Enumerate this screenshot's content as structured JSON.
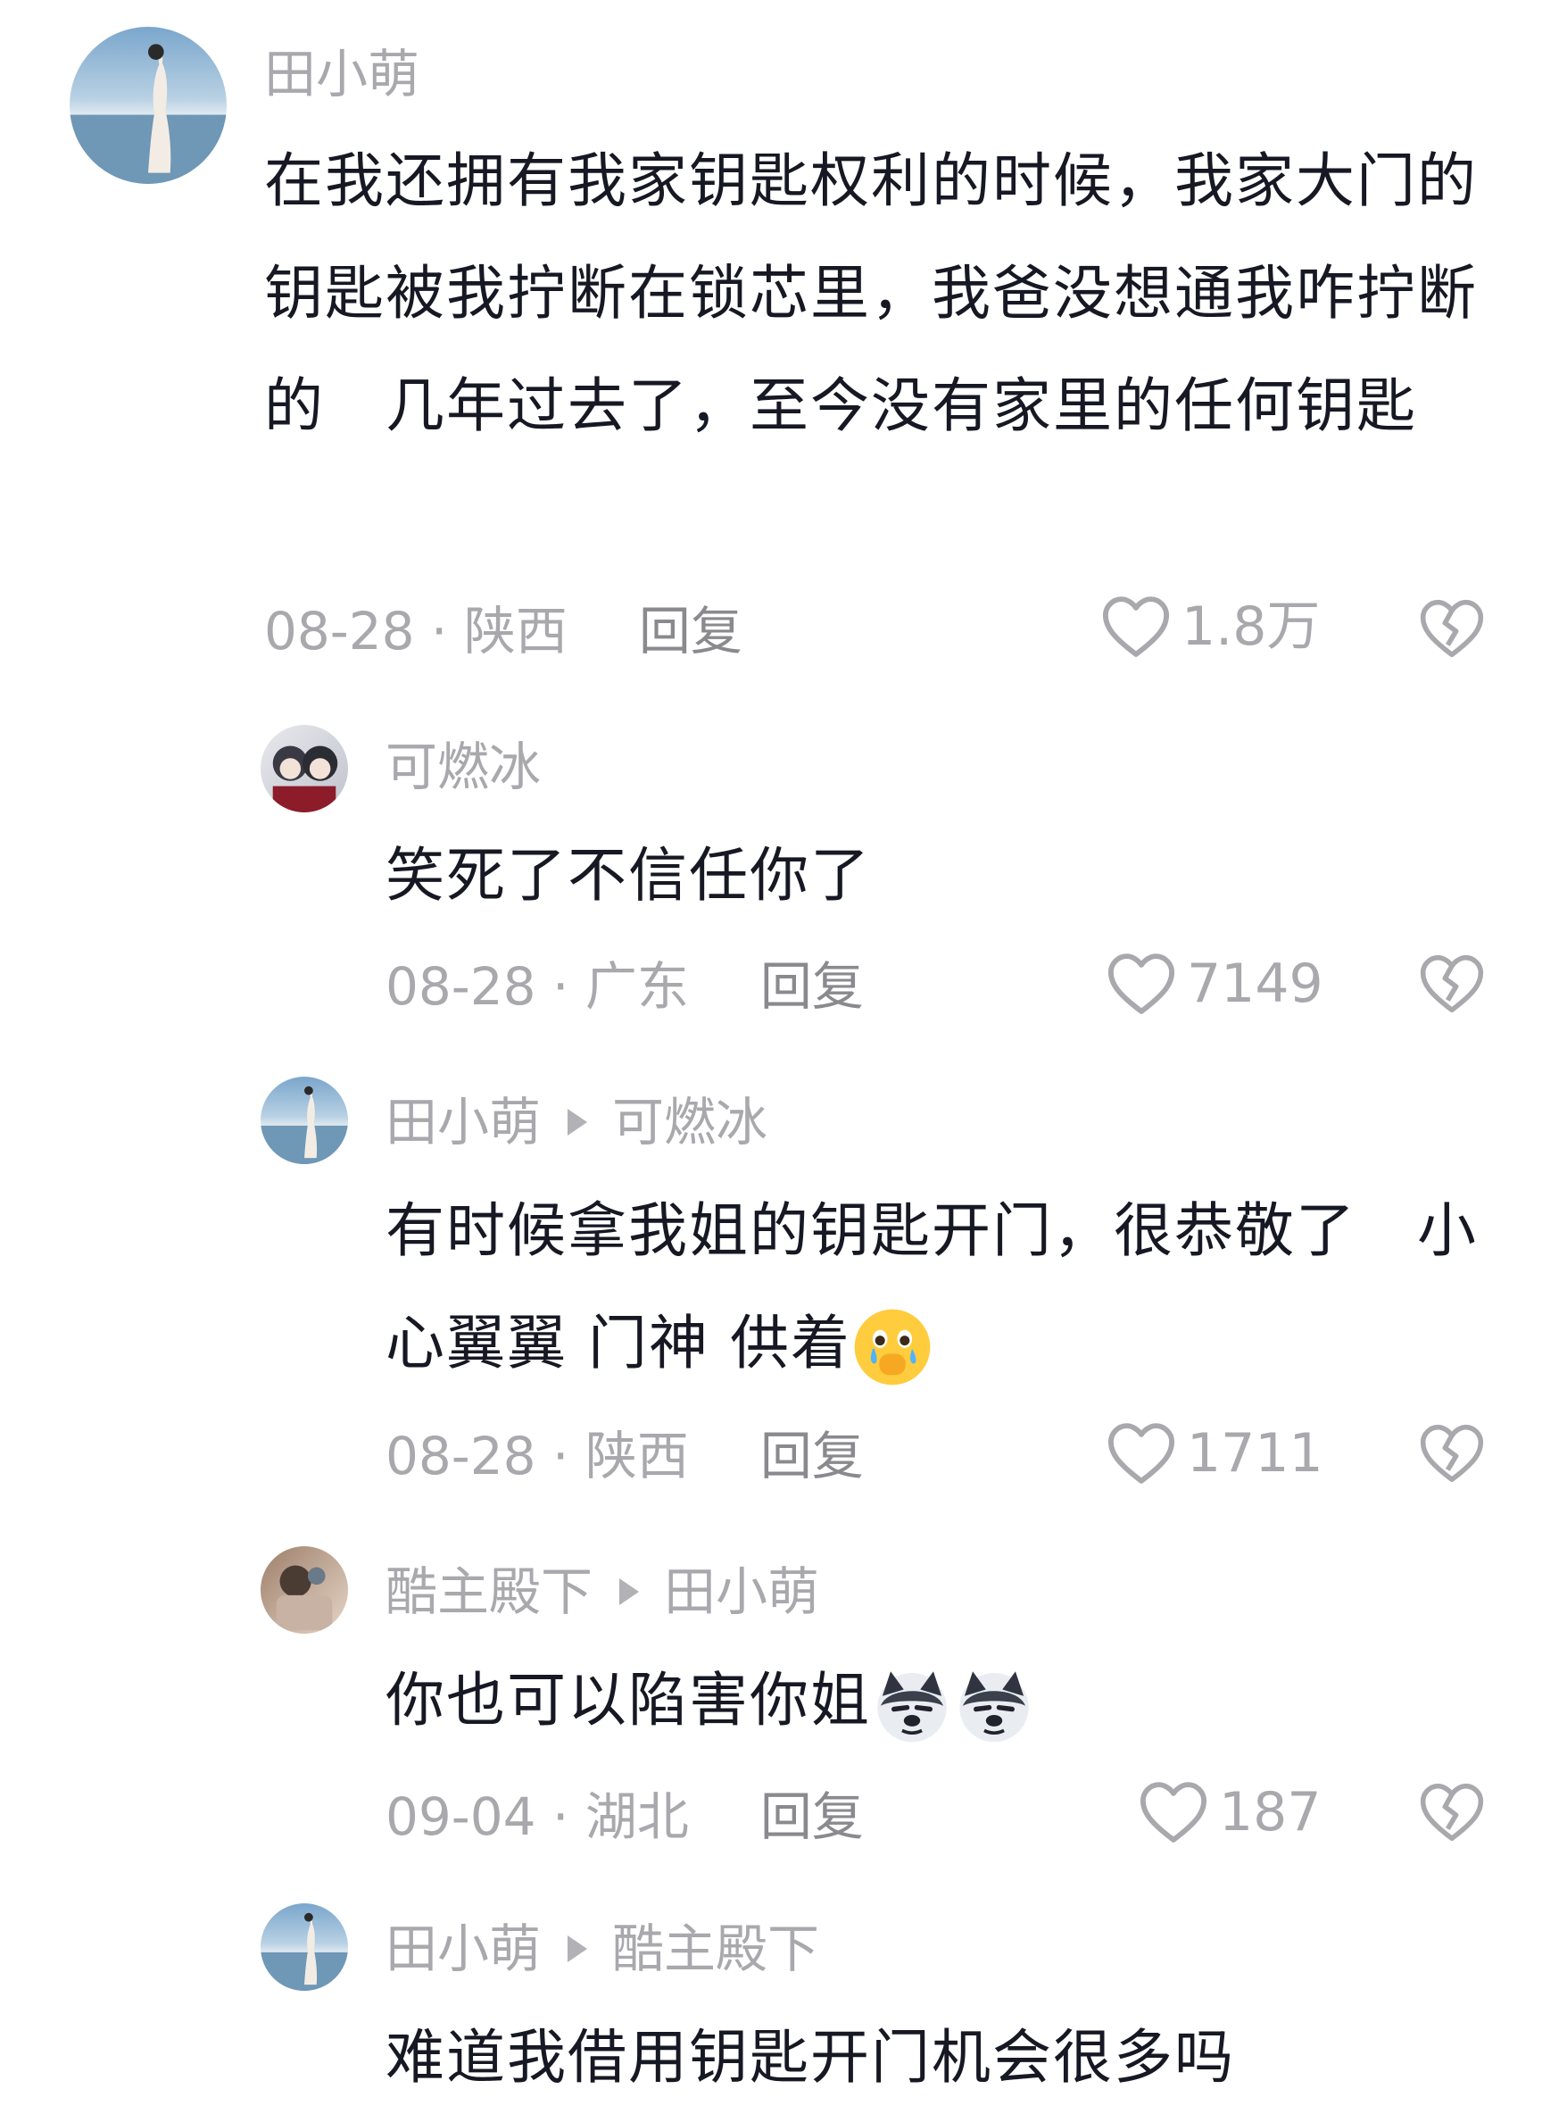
{
  "comments": [
    {
      "user": "田小萌",
      "text": "在我还拥有我家钥匙权利的时候，我家大门的钥匙被我拧断在锁芯里，我爸没想通我咋拧断的　几年过去了，至今没有家里的任何钥匙",
      "date_location": "08-28 · 陕西",
      "reply_label": "回复",
      "likes": "1.8万"
    },
    {
      "user": "可燃冰",
      "text": "笑死了不信任你了",
      "date_location": "08-28 · 广东",
      "reply_label": "回复",
      "likes": "7149"
    },
    {
      "user": "田小萌",
      "reply_to": "可燃冰",
      "text": "有时候拿我姐的钥匙开门，很恭敬了　小心翼翼 门神 供着",
      "emoji": "teary-hand-over-mouth",
      "date_location": "08-28 · 陕西",
      "reply_label": "回复",
      "likes": "1711"
    },
    {
      "user": "酷主殿下",
      "reply_to": "田小萌",
      "text": "你也可以陷害你姐",
      "emoji": "sly-dog",
      "date_location": "09-04 · 湖北",
      "reply_label": "回复",
      "likes": "187"
    },
    {
      "user": "田小萌",
      "reply_to": "酷主殿下",
      "text": "难道我借用钥匙开门机会很多吗"
    }
  ],
  "colors": {
    "text": "#161823",
    "secondary": "#a8a8ad",
    "background": "#ffffff"
  }
}
